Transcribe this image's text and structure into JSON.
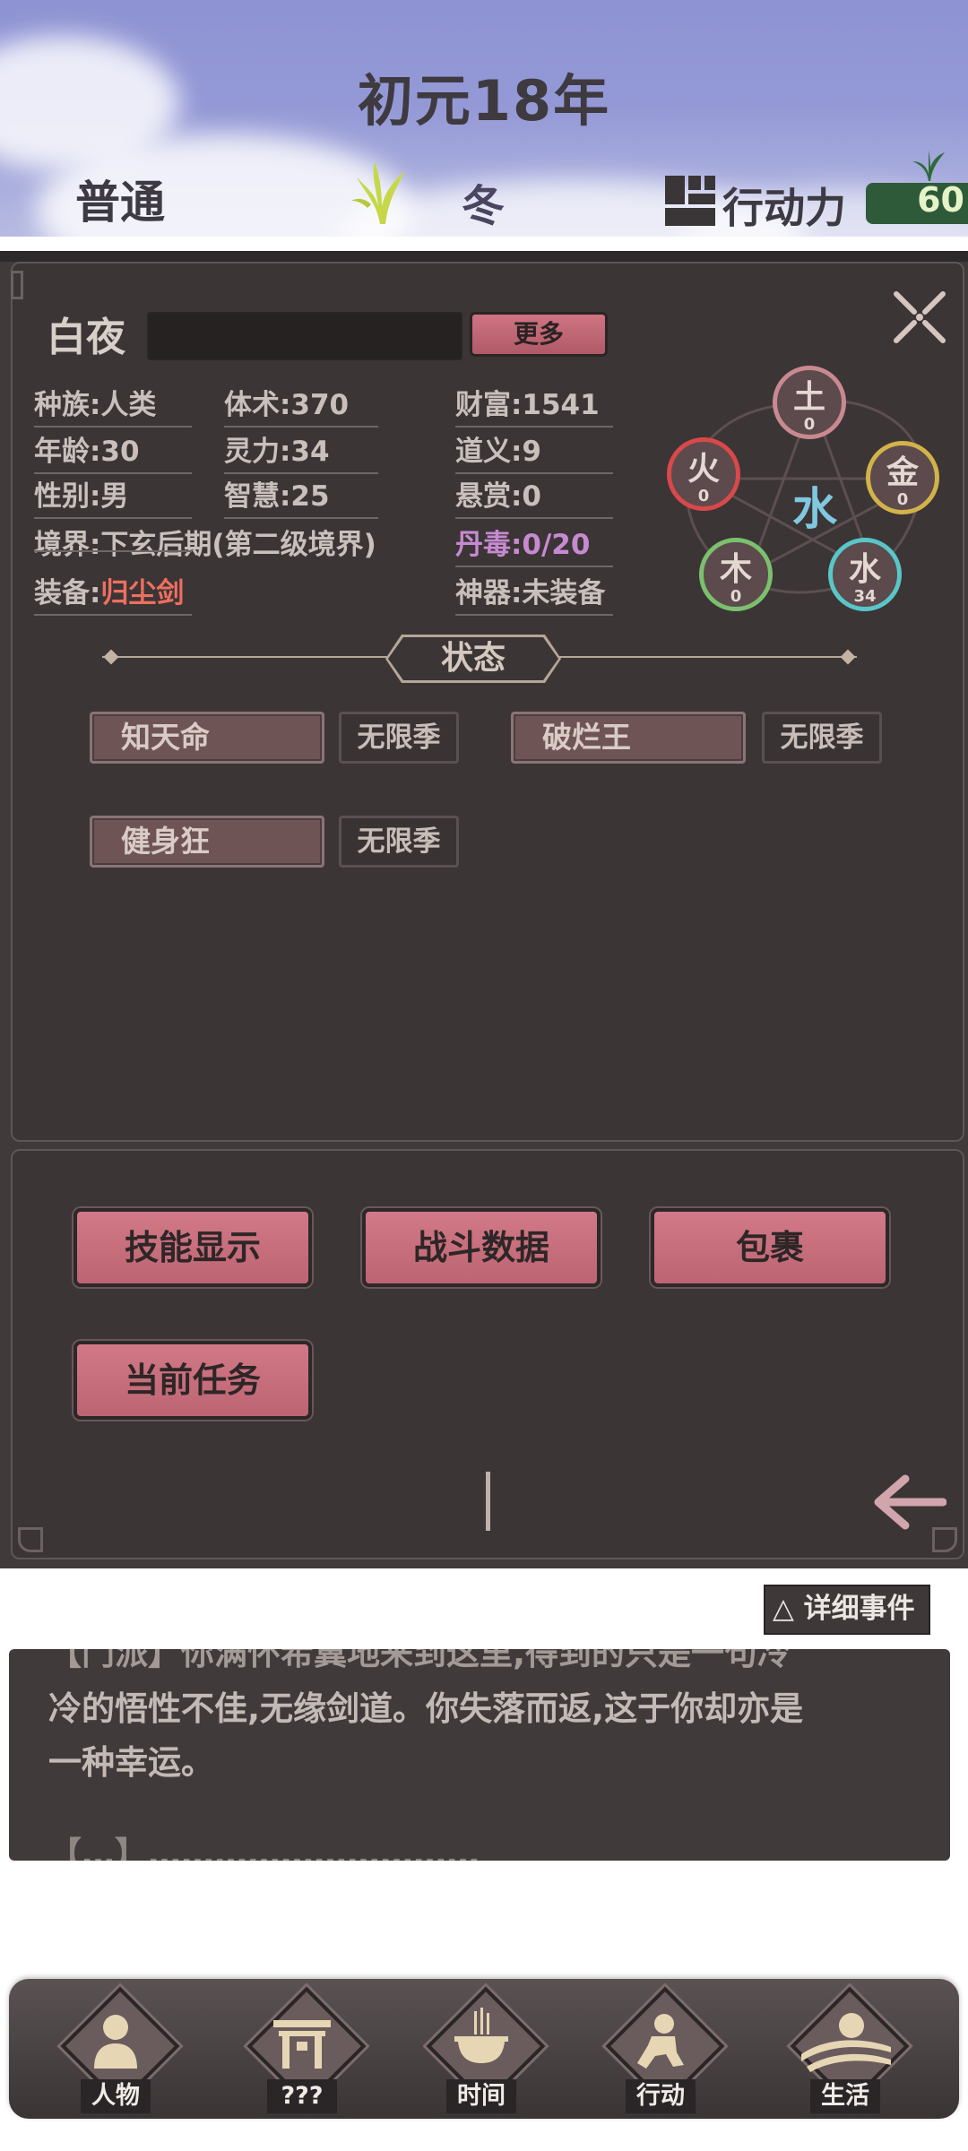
{
  "header": {
    "year_title": "初元18年",
    "difficulty": "普通",
    "season": "冬",
    "action_label": "行动力",
    "action_points": "60"
  },
  "character": {
    "name": "白夜",
    "more_button": "更多",
    "stats": {
      "race": "种族:人类",
      "age": "年龄:30",
      "gender": "性别:男",
      "realm": "境界:下玄后期(第二级境界)",
      "equipment_label": "装备:",
      "equipment_value": "归尘剑",
      "body_art": "体术:370",
      "spirit": "灵力:34",
      "wisdom": "智慧:25",
      "wealth": "财富:1541",
      "morality": "道义:9",
      "bounty": "悬赏:0",
      "poison": "丹毒:0/20",
      "artifact": "神器:未装备"
    },
    "five_elements": {
      "center": "水",
      "earth": {
        "name": "土",
        "value": "0"
      },
      "metal": {
        "name": "金",
        "value": "0"
      },
      "water": {
        "name": "水",
        "value": "34"
      },
      "wood": {
        "name": "木",
        "value": "0"
      },
      "fire": {
        "name": "火",
        "value": "0"
      }
    }
  },
  "status_section": {
    "title": "状态",
    "buffs": [
      {
        "name": "知天命",
        "duration": "无限季"
      },
      {
        "name": "破烂王",
        "duration": "无限季"
      },
      {
        "name": "健身狂",
        "duration": "无限季"
      }
    ]
  },
  "actions": {
    "skills": "技能显示",
    "battle_data": "战斗数据",
    "inventory": "包裹",
    "current_quest": "当前任务"
  },
  "events": {
    "detail_button": "△ 详细事件",
    "lines": [
      "【门派】你满怀希冀地来到这里,得到的只是一句冷",
      "冷的悟性不佳,无缘剑道。你失落而返,这于你却亦是",
      "一种幸运。",
      "【…】…………………………"
    ]
  },
  "nav": [
    {
      "label": "人物",
      "icon": "person-icon"
    },
    {
      "label": "???",
      "icon": "gate-icon"
    },
    {
      "label": "时间",
      "icon": "incense-burner-icon"
    },
    {
      "label": "行动",
      "icon": "action-figure-icon"
    },
    {
      "label": "生活",
      "icon": "sunrise-field-icon"
    }
  ],
  "colors": {
    "panel_bg": "#403a3b",
    "button_pink": "#c96d7b",
    "equipment_accent": "#ee6f5f",
    "poison_accent": "#c78ad1",
    "earth_ring": "#c88a90",
    "metal_ring": "#d2b34a",
    "water_ring": "#59c6c8",
    "wood_ring": "#7bc06e",
    "fire_ring": "#d9484a",
    "action_points_bg": "#2f5a39"
  }
}
